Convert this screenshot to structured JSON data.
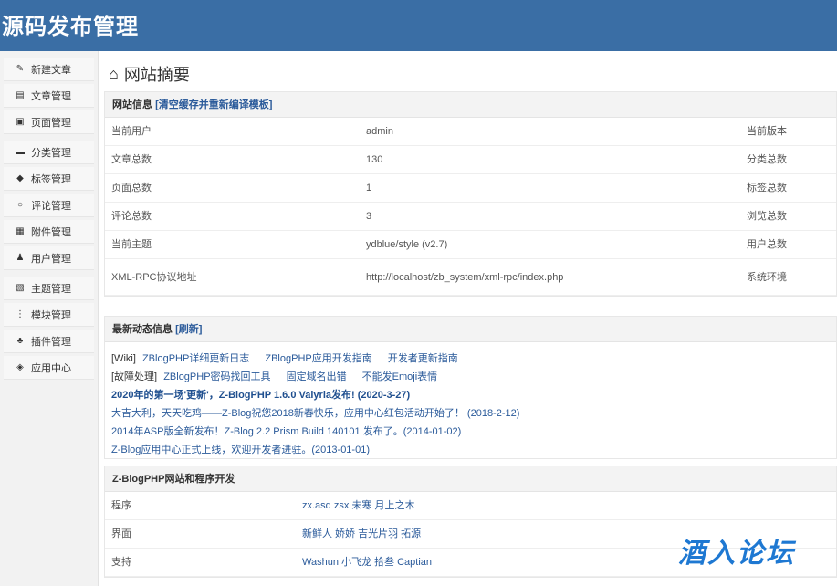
{
  "app": {
    "title": "源码发布管理"
  },
  "sidebar": {
    "items": [
      {
        "label": "新建文章",
        "icon": "edit-icon"
      },
      {
        "label": "文章管理",
        "icon": "document-icon"
      },
      {
        "label": "页面管理",
        "icon": "page-icon"
      },
      {
        "label": "分类管理",
        "icon": "folder-icon"
      },
      {
        "label": "标签管理",
        "icon": "tag-icon"
      },
      {
        "label": "评论管理",
        "icon": "comment-icon"
      },
      {
        "label": "附件管理",
        "icon": "attachment-icon"
      },
      {
        "label": "用户管理",
        "icon": "user-icon"
      },
      {
        "label": "主题管理",
        "icon": "theme-icon"
      },
      {
        "label": "模块管理",
        "icon": "module-icon"
      },
      {
        "label": "插件管理",
        "icon": "plugin-icon"
      },
      {
        "label": "应用中心",
        "icon": "app-center-icon"
      }
    ]
  },
  "page": {
    "title": "网站摘要"
  },
  "site_info": {
    "title": "网站信息",
    "action": "[清空缓存并重新编译模板]",
    "rows": [
      {
        "label": "当前用户",
        "value": "admin",
        "right_label": "当前版本"
      },
      {
        "label": "文章总数",
        "value": "130",
        "right_label": "分类总数"
      },
      {
        "label": "页面总数",
        "value": "1",
        "right_label": "标签总数"
      },
      {
        "label": "评论总数",
        "value": "3",
        "right_label": "浏览总数"
      },
      {
        "label": "当前主题",
        "value": "ydblue/style (v2.7)",
        "right_label": "用户总数"
      },
      {
        "label": "XML-RPC协议地址",
        "value": "http://localhost/zb_system/xml-rpc/index.php",
        "right_label": "系统环境"
      }
    ]
  },
  "news": {
    "title": "最新动态信息",
    "action": "[刷新]",
    "wiki": {
      "label": "[Wiki]",
      "links": [
        "ZBlogPHP详细更新日志",
        "ZBlogPHP应用开发指南",
        "开发者更新指南"
      ]
    },
    "fault": {
      "label": "[故障处理]",
      "links": [
        "ZBlogPHP密码找回工具",
        "固定域名出错",
        "不能发Emoji表情"
      ]
    },
    "items": [
      "2020年的第一场'更新'，Z-BlogPHP 1.6.0 Valyria发布! (2020-3-27)",
      "大吉大利，天天吃鸡——Z-Blog祝您2018新春快乐，应用中心红包活动开始了！ (2018-2-12)",
      "2014年ASP版全新发布！Z-Blog 2.2 Prism Build 140101 发布了。(2014-01-02)",
      "Z-Blog应用中心正式上线，欢迎开发者进驻。(2013-01-01)"
    ]
  },
  "dev": {
    "title": "Z-BlogPHP网站和程序开发",
    "rows": [
      {
        "label": "程序",
        "value": "zx.asd zsx 未寒 月上之木"
      },
      {
        "label": "界面",
        "value": "新鲜人 娇娇 吉光片羽 拓源"
      },
      {
        "label": "支持",
        "value": "Washun 小飞龙 拾叁 Captian"
      }
    ]
  },
  "watermark": {
    "text": "酒入论坛"
  },
  "colors": {
    "header": "#3a6ea5",
    "link": "#2a5a9a",
    "watermark": "#1e78d2"
  }
}
